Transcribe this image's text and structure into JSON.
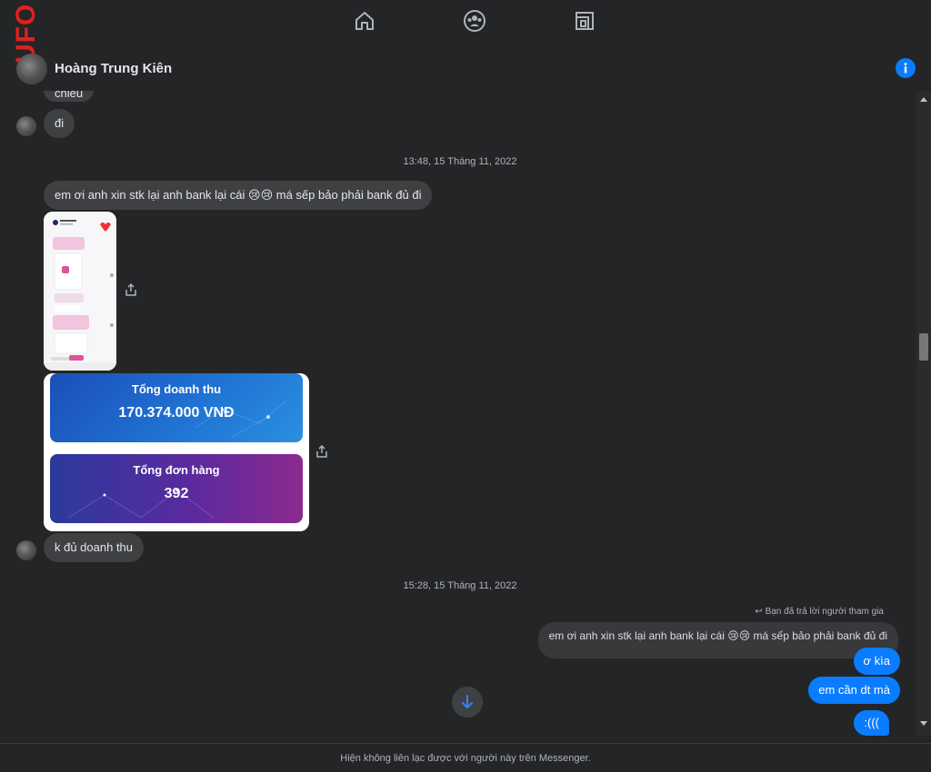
{
  "app": {
    "side_logo_text": "UFO"
  },
  "nav": {
    "icons": [
      "home-icon",
      "groups-icon",
      "marketplace-icon"
    ]
  },
  "header": {
    "contact_name": "Hoàng Trung Kiên"
  },
  "messages": {
    "partial_top": "chiều",
    "msg_di": "đi",
    "timestamp_1": "13:48, 15 Tháng 11, 2022",
    "msg_stk": "em ơi anh xin stk lại anh bank lại cái 😢😢 má sếp bảo phải bank đủ đi",
    "card_revenue_label": "Tổng doanh thu",
    "card_revenue_value": "170.374.000 VNĐ",
    "card_orders_label": "Tổng đơn hàng",
    "card_orders_value": "392",
    "msg_not_enough": "k đủ doanh thu",
    "timestamp_2": "15:28, 15 Tháng 11, 2022",
    "reply_note": "Bạn đã trả lời người tham gia",
    "quoted_text": "em ơi anh xin stk lại anh bank lại cái 😢😢 má sếp bảo phải bank đủ đi",
    "out_1": "ơ kìa",
    "out_2": "em cần dt mà",
    "out_3": ":((("
  },
  "footer": {
    "notice": "Hiện không liên lạc được với người này trên Messenger."
  },
  "colors": {
    "background": "#242526",
    "incoming_bubble": "#3e4042",
    "outgoing_bubble": "#0a7cff",
    "secondary_text": "#b0b3b8"
  }
}
